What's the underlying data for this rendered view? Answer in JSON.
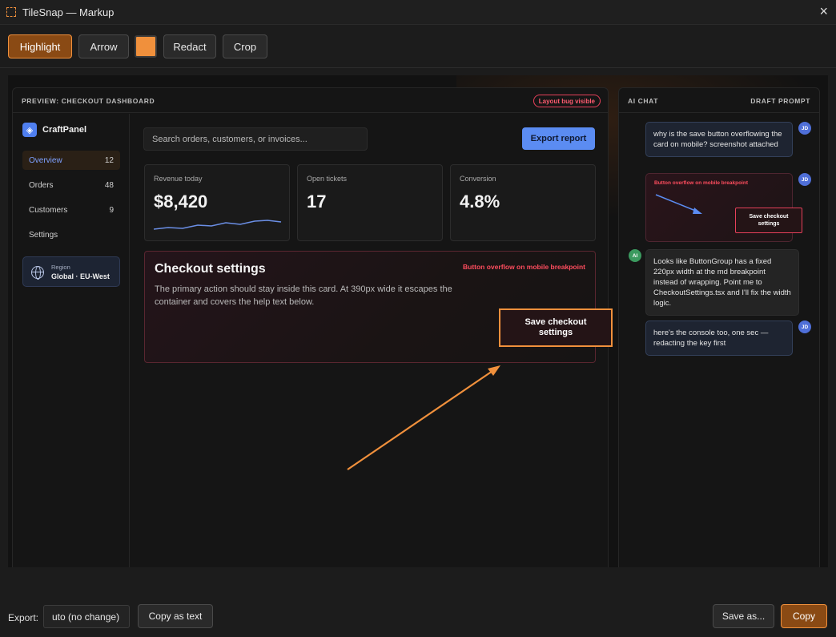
{
  "window": {
    "title": "TileSnap — Markup",
    "close_icon": "×"
  },
  "toolbar": {
    "highlight": "Highlight",
    "arrow": "Arrow",
    "color": "#f0903c",
    "redact": "Redact",
    "crop": "Crop"
  },
  "preview": {
    "title": "PREVIEW: CHECKOUT DASHBOARD",
    "badge": "Layout bug visible",
    "brand": "CraftPanel",
    "nav": [
      {
        "label": "Overview",
        "count": "12"
      },
      {
        "label": "Orders",
        "count": "48"
      },
      {
        "label": "Customers",
        "count": "9"
      },
      {
        "label": "Settings",
        "count": ""
      }
    ],
    "region_label": "Region",
    "region_value": "Global · EU-West",
    "search_placeholder": "Search orders, customers, or invoices...",
    "export_button": "Export report",
    "stats": [
      {
        "label": "Revenue today",
        "value": "$8,420"
      },
      {
        "label": "Open tickets",
        "value": "17"
      },
      {
        "label": "Conversion",
        "value": "4.8%"
      }
    ],
    "card": {
      "title": "Checkout settings",
      "bug": "Button overflow on mobile breakpoint",
      "desc": "The primary action should stay inside this card. At 390px wide it escapes the container and covers the help text below.",
      "button": "Save checkout settings"
    }
  },
  "chat": {
    "title": "AI CHAT",
    "mode": "DRAFT PROMPT",
    "messages": [
      {
        "from": "JD",
        "text": "why is the save button overflowing the card on mobile? screenshot attached"
      },
      {
        "from": "JD",
        "attachment_label": "Button overflow on mobile breakpoint",
        "attachment_button": "Save checkout settings"
      },
      {
        "from": "AI",
        "text": "Looks like ButtonGroup has a fixed 220px width at the md breakpoint instead of wrapping. Point me to CheckoutSettings.tsx and I'll fix the width logic."
      },
      {
        "from": "JD",
        "text": "here's the console too, one sec — redacting the key first"
      }
    ]
  },
  "bottom": {
    "export_label": "Export:",
    "export_value": "uto (no change)",
    "copy_text": "Copy as text",
    "save_as": "Save as...",
    "copy": "Copy"
  }
}
